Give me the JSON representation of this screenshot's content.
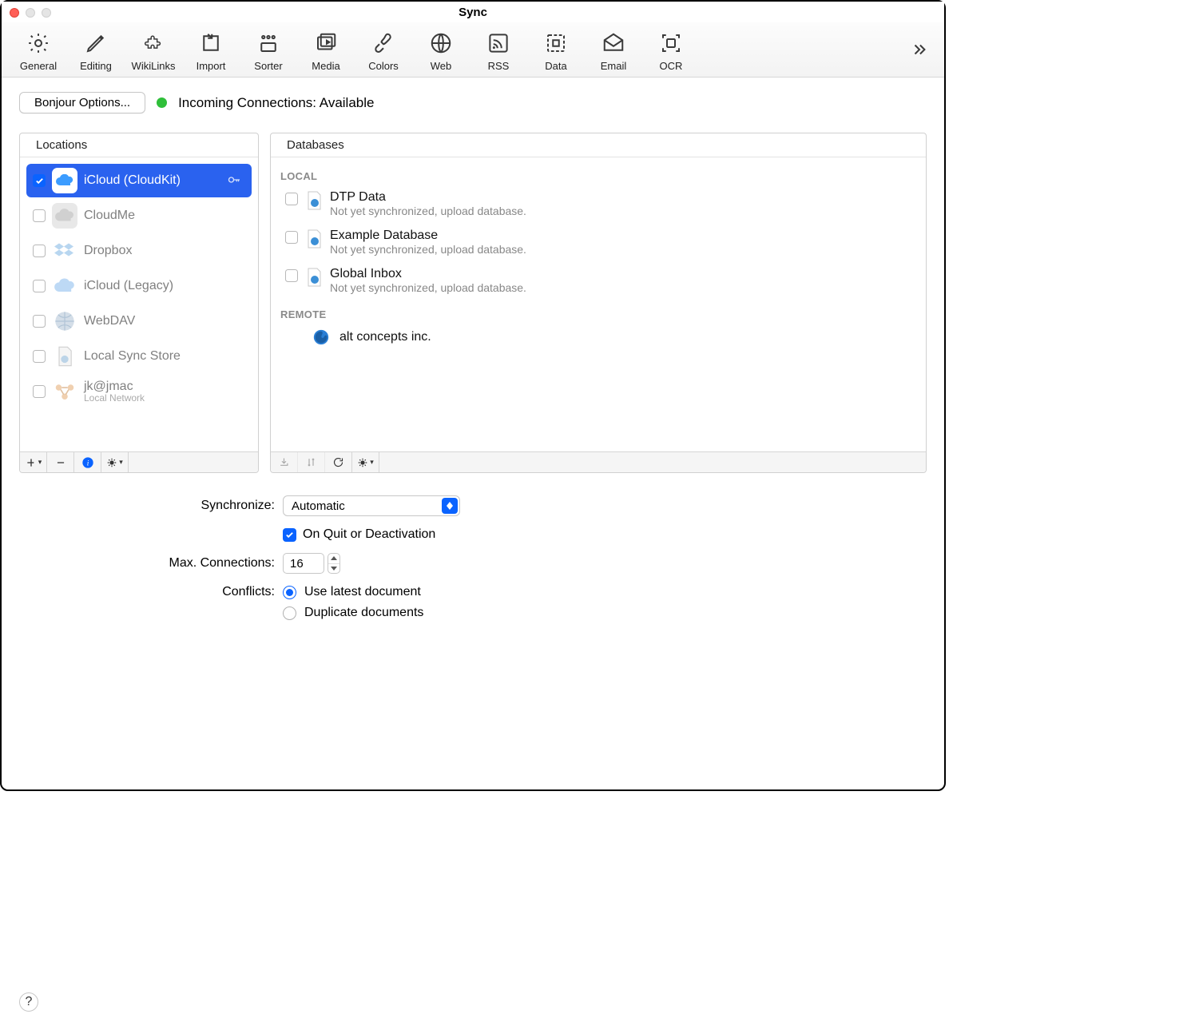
{
  "window": {
    "title": "Sync"
  },
  "toolbar": {
    "items": [
      {
        "label": "General"
      },
      {
        "label": "Editing"
      },
      {
        "label": "WikiLinks"
      },
      {
        "label": "Import"
      },
      {
        "label": "Sorter"
      },
      {
        "label": "Media"
      },
      {
        "label": "Colors"
      },
      {
        "label": "Web"
      },
      {
        "label": "RSS"
      },
      {
        "label": "Data"
      },
      {
        "label": "Email"
      },
      {
        "label": "OCR"
      }
    ]
  },
  "bonjour": {
    "button_label": "Bonjour Options...",
    "status": "Incoming Connections: Available"
  },
  "locations": {
    "header": "Locations",
    "items": [
      {
        "label": "iCloud (CloudKit)",
        "sub": "",
        "checked": true,
        "selected": true,
        "icon": "icloud",
        "hasKey": true
      },
      {
        "label": "CloudMe",
        "sub": "",
        "checked": false,
        "selected": false,
        "icon": "cloud"
      },
      {
        "label": "Dropbox",
        "sub": "",
        "checked": false,
        "selected": false,
        "icon": "dropbox"
      },
      {
        "label": "iCloud (Legacy)",
        "sub": "",
        "checked": false,
        "selected": false,
        "icon": "icloud-gray"
      },
      {
        "label": "WebDAV",
        "sub": "",
        "checked": false,
        "selected": false,
        "icon": "globe"
      },
      {
        "label": "Local Sync Store",
        "sub": "",
        "checked": false,
        "selected": false,
        "icon": "doc"
      },
      {
        "label": "jk@jmac",
        "sub": "Local Network",
        "checked": false,
        "selected": false,
        "icon": "network"
      }
    ]
  },
  "databases": {
    "header": "Databases",
    "local_label": "LOCAL",
    "remote_label": "REMOTE",
    "local": [
      {
        "name": "DTP Data",
        "status": "Not yet synchronized, upload database."
      },
      {
        "name": "Example Database",
        "status": "Not yet synchronized, upload database."
      },
      {
        "name": "Global Inbox",
        "status": "Not yet synchronized, upload database."
      }
    ],
    "remote": [
      {
        "name": "alt concepts inc."
      }
    ]
  },
  "settings": {
    "synchronize_label": "Synchronize:",
    "synchronize_value": "Automatic",
    "on_quit_label": "On Quit or Deactivation",
    "max_conn_label": "Max. Connections:",
    "max_conn_value": "16",
    "conflicts_label": "Conflicts:",
    "conflicts_opt1": "Use latest document",
    "conflicts_opt2": "Duplicate documents"
  },
  "help": "?"
}
